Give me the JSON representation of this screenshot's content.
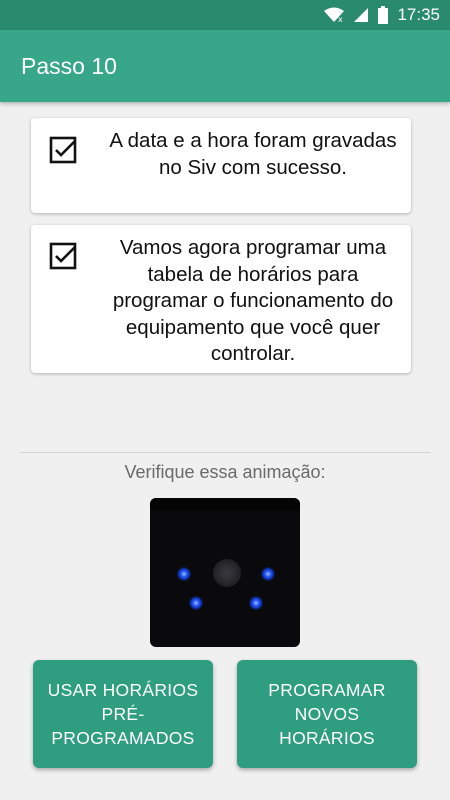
{
  "status_bar": {
    "time": "17:35",
    "icons": [
      "wifi-icon",
      "signal-icon",
      "battery-icon"
    ],
    "color": "#2a8a6d"
  },
  "app_bar": {
    "title": "Passo 10",
    "color": "#37a689"
  },
  "cards": [
    {
      "text": "A data e a hora foram gravadas no Siv com sucesso.",
      "icon": "checkbox-checked-icon"
    },
    {
      "text": "Vamos agora programar uma tabela de horários para programar o funcionamento do equipamento que você quer controlar.",
      "icon": "checkbox-checked-icon"
    }
  ],
  "animation": {
    "label": "Verifique essa animação:",
    "led_color": "#2a5cff"
  },
  "buttons": {
    "use_preset": "USAR HORÁRIOS PRÉ-PROGRAMADOS",
    "program_new": "PROGRAMAR NOVOS HORÁRIOS",
    "color": "#2f9e80"
  }
}
